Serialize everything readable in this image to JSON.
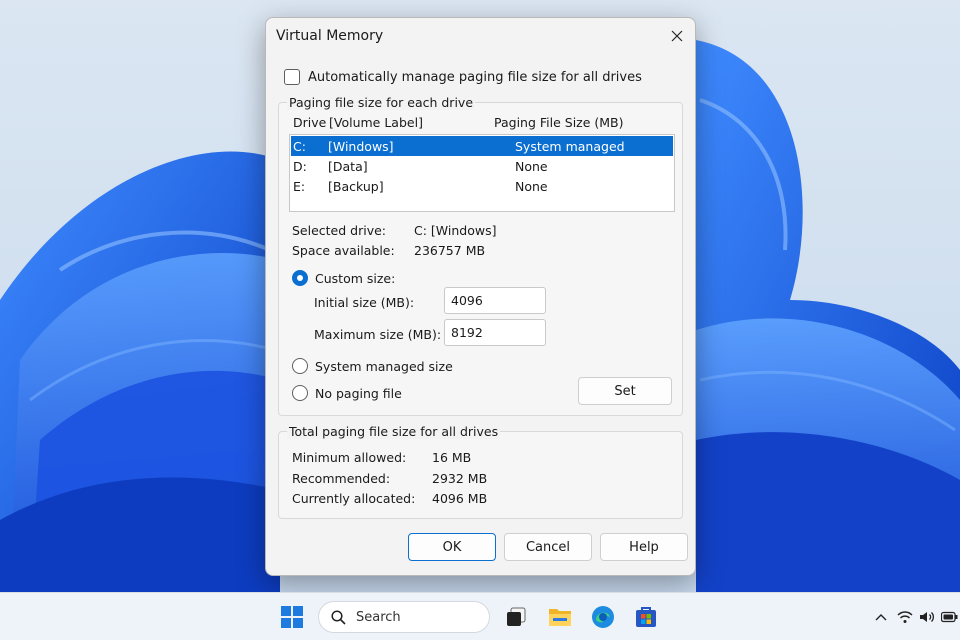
{
  "dialog": {
    "title": "Virtual Memory",
    "auto_manage_label": "Automatically manage paging file size for all drives",
    "per_drive_group_title": "Paging file size for each drive",
    "list_headers": {
      "drive": "Drive",
      "volume_label": "[Volume Label]",
      "paging_size": "Paging File Size (MB)"
    },
    "drives": [
      {
        "drive": "C:",
        "label": "[Windows]",
        "size": "System managed",
        "selected": true
      },
      {
        "drive": "D:",
        "label": "[Data]",
        "size": "None",
        "selected": false
      },
      {
        "drive": "E:",
        "label": "[Backup]",
        "size": "None",
        "selected": false
      }
    ],
    "selected_drive_label": "Selected drive:",
    "selected_drive_value": "C:  [Windows]",
    "space_available_label": "Space available:",
    "space_available_value": "236757 MB",
    "custom_size_label": "Custom size:",
    "initial_size_label": "Initial size (MB):",
    "initial_size_value": "4096",
    "maximum_size_label": "Maximum size (MB):",
    "maximum_size_value": "8192",
    "system_managed_label": "System managed size",
    "no_paging_label": "No paging file",
    "set_button": "Set",
    "totals_group_title": "Total paging file size for all drives",
    "minimum_allowed_label": "Minimum allowed:",
    "minimum_allowed_value": "16 MB",
    "recommended_label": "Recommended:",
    "recommended_value": "2932 MB",
    "currently_allocated_label": "Currently allocated:",
    "currently_allocated_value": "4096 MB",
    "ok_button": "OK",
    "cancel_button": "Cancel",
    "help_button": "Help",
    "selected_radio": "custom",
    "auto_manage_checked": false
  },
  "taskbar": {
    "search_placeholder": "Search",
    "icons": [
      "windows-start-icon",
      "search-icon",
      "task-view-icon",
      "file-explorer-icon",
      "edge-browser-icon",
      "microsoft-store-icon"
    ],
    "tray_icons": [
      "chevron-up-icon",
      "wifi-icon",
      "volume-icon",
      "battery-icon"
    ]
  },
  "colors": {
    "accent": "#0a6fd1",
    "wallpaper_blue": "#1a5fe0"
  }
}
